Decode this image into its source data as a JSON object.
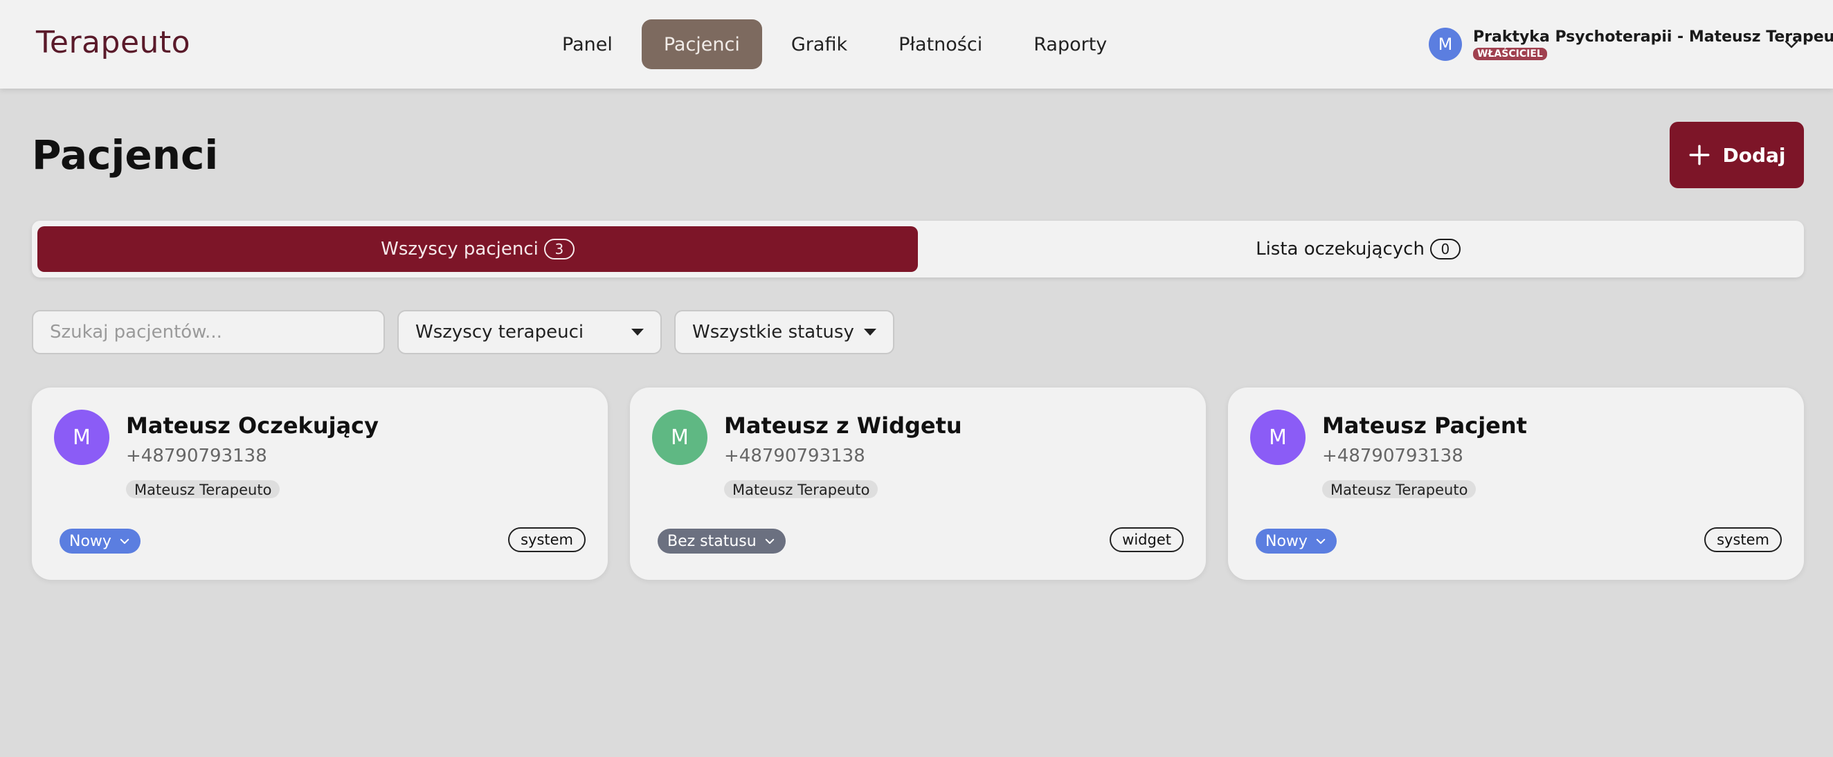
{
  "app": {
    "logo": "Terapeuto"
  },
  "nav": {
    "items": [
      {
        "label": "Panel",
        "active": false
      },
      {
        "label": "Pacjenci",
        "active": true
      },
      {
        "label": "Grafik",
        "active": false
      },
      {
        "label": "Płatności",
        "active": false
      },
      {
        "label": "Raporty",
        "active": false
      }
    ]
  },
  "user": {
    "initial": "M",
    "name": "Praktyka Psychoterapii - Mateusz Terapeuto",
    "role": "WŁAŚCICIEL",
    "icon": "chevron-down-icon"
  },
  "page": {
    "title": "Pacjenci",
    "add_label": "Dodaj",
    "add_icon": "plus-icon"
  },
  "tabs": [
    {
      "label": "Wszyscy pacjenci",
      "count": "3",
      "active": true
    },
    {
      "label": "Lista oczekujących",
      "count": "0",
      "active": false
    }
  ],
  "filters": {
    "search_placeholder": "Szukaj pacjentów...",
    "therapist_selected": "Wszyscy terapeuci",
    "status_selected": "Wszystkie statusy"
  },
  "patients": [
    {
      "initial": "M",
      "name": "Mateusz Oczekujący",
      "phone": "+48790793138",
      "therapist": "Mateusz Terapeuto",
      "status": "Nowy",
      "source": "system",
      "avatar_color": "#8b5cf6",
      "status_color": "#5b7ee0"
    },
    {
      "initial": "M",
      "name": "Mateusz z Widgetu",
      "phone": "+48790793138",
      "therapist": "Mateusz Terapeuto",
      "status": "Bez statusu",
      "source": "widget",
      "avatar_color": "#5fb883",
      "status_color": "#6b7080"
    },
    {
      "initial": "M",
      "name": "Mateusz Pacjent",
      "phone": "+48790793138",
      "therapist": "Mateusz Terapeuto",
      "status": "Nowy",
      "source": "system",
      "avatar_color": "#8b5cf6",
      "status_color": "#5b7ee0"
    }
  ],
  "colors": {
    "brand": "#7d1528",
    "nav_active": "#7d6a5f",
    "background": "#dbdbdb"
  }
}
